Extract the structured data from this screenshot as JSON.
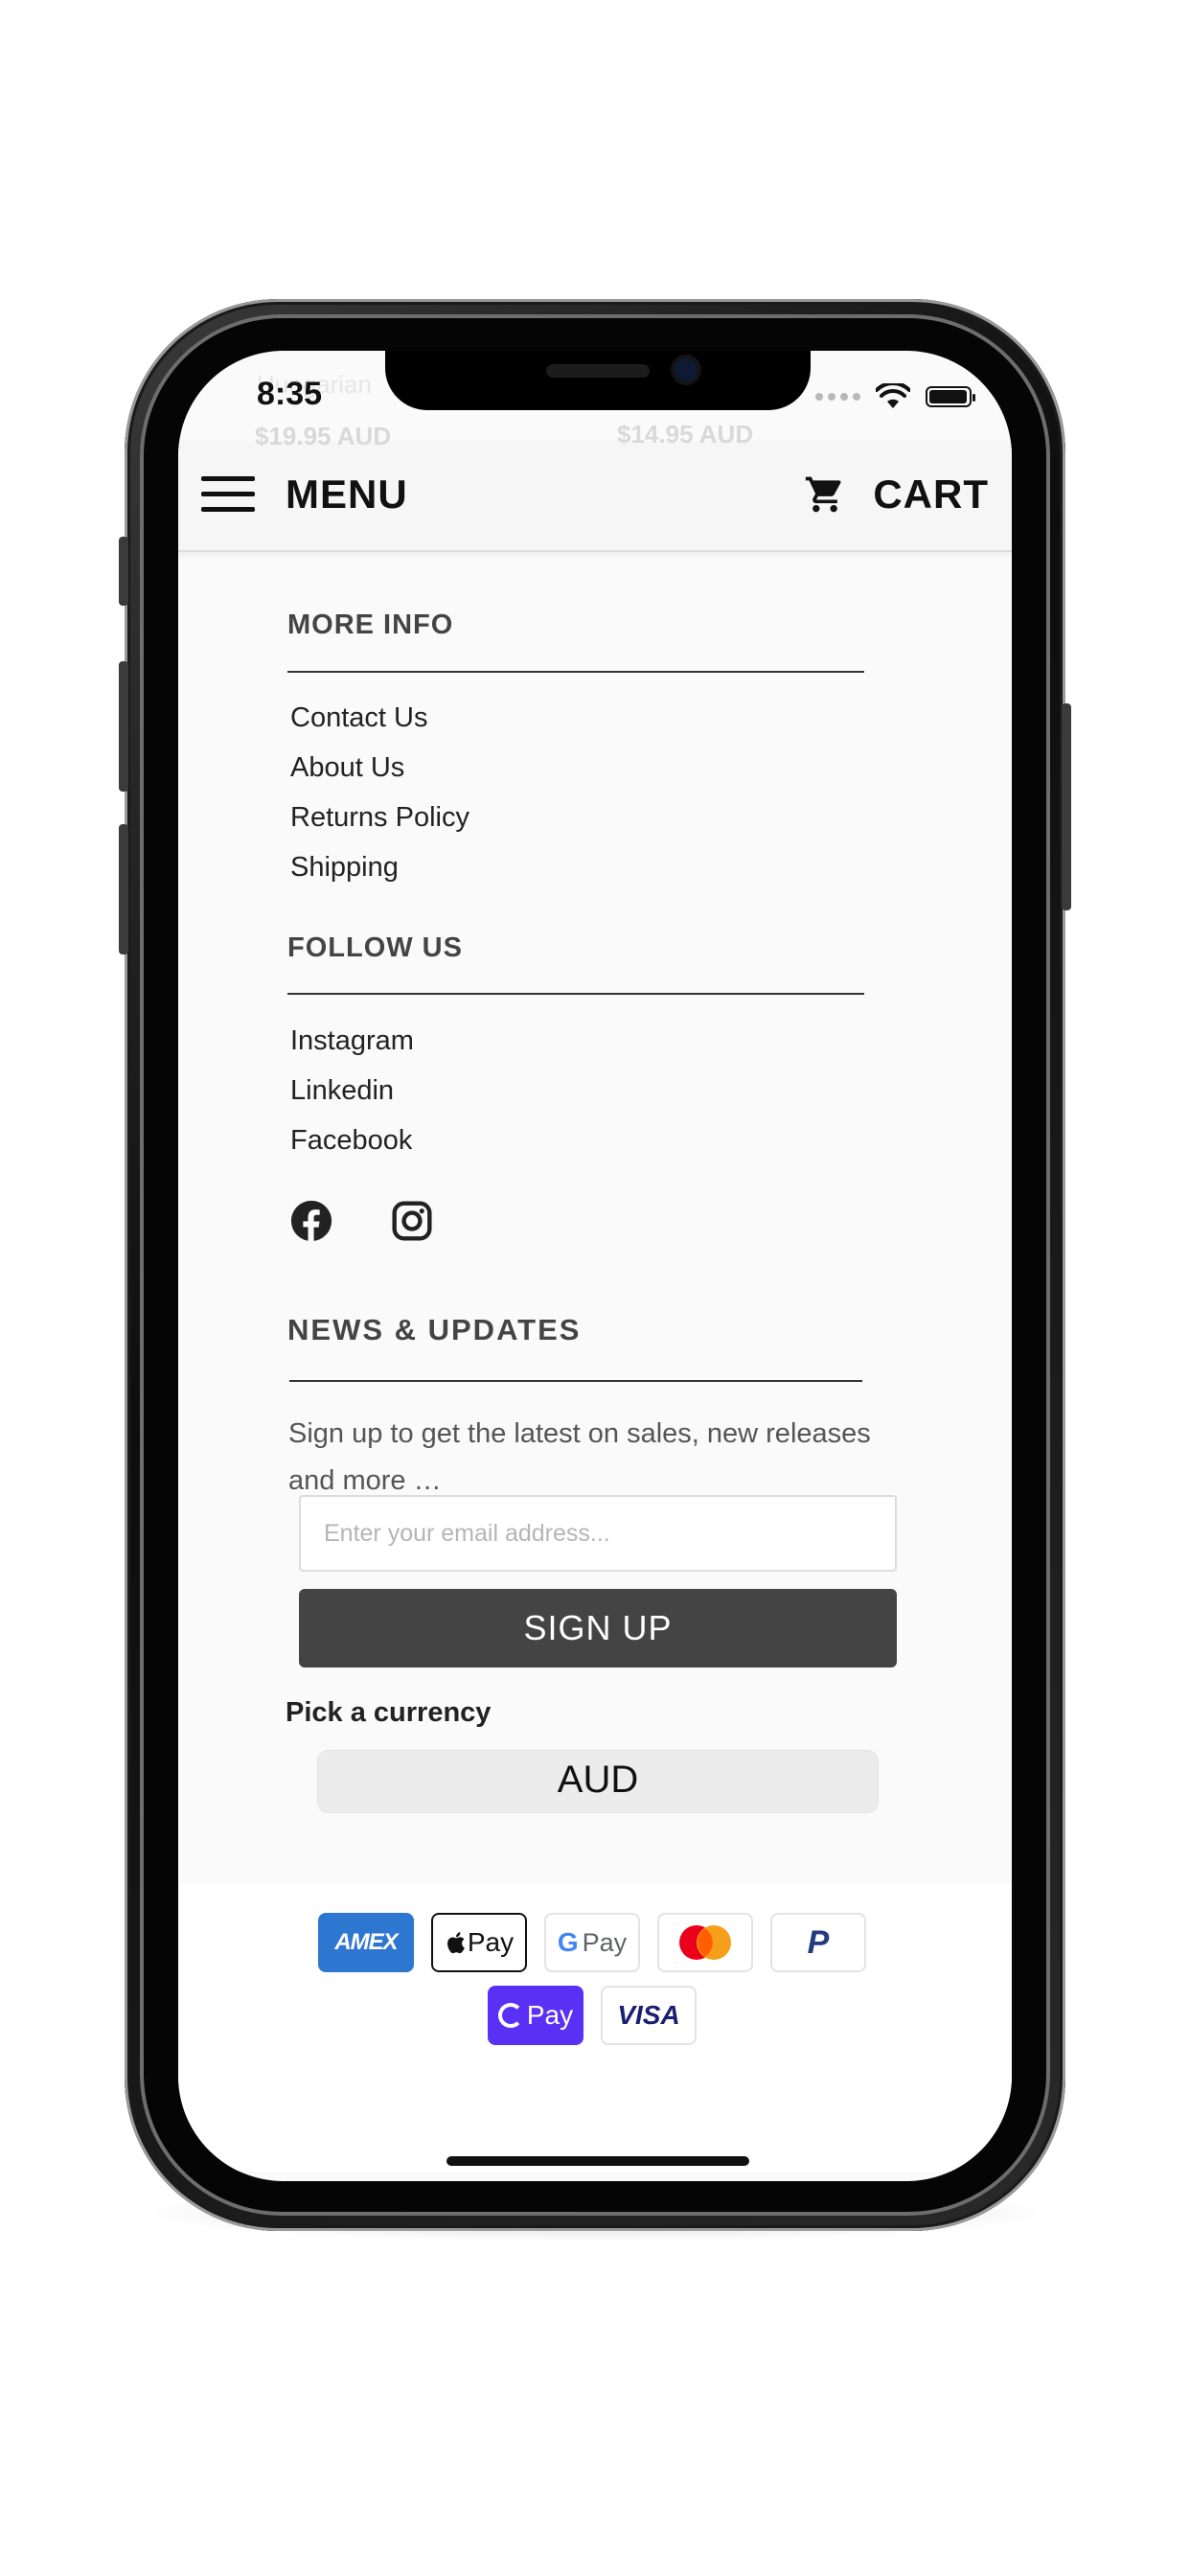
{
  "status_bar": {
    "time": "8:35"
  },
  "background_products": {
    "left_name": "Hungarian",
    "left_price": "$19.95 AUD",
    "right_price": "$14.95 AUD"
  },
  "header": {
    "menu_label": "MENU",
    "cart_label": "CART"
  },
  "more_info": {
    "title": "MORE INFO",
    "links": [
      "Contact Us",
      "About Us",
      "Returns Policy",
      "Shipping"
    ]
  },
  "follow_us": {
    "title": "FOLLOW US",
    "links": [
      "Instagram",
      "Linkedin",
      "Facebook"
    ],
    "icons": [
      "facebook-icon",
      "instagram-icon"
    ]
  },
  "news": {
    "title": "NEWS & UPDATES",
    "description": "Sign up to get the latest on sales, new releases and more …",
    "email_placeholder": "Enter your email address...",
    "email_value": "",
    "signup_label": "SIGN UP"
  },
  "currency": {
    "label": "Pick a currency",
    "selected": "AUD"
  },
  "payments": {
    "amex": "AMEX",
    "apple_pay": "Pay",
    "google_pay": "Pay",
    "paypal": "P",
    "shop_pay": "Pay",
    "visa": "VISA"
  },
  "colors": {
    "header_bg": "#f6f6f6",
    "signup_bg": "#444444",
    "amex_blue": "#2e77d0",
    "shop_pay_purple": "#5a31f4",
    "visa_navy": "#1a1f71"
  }
}
